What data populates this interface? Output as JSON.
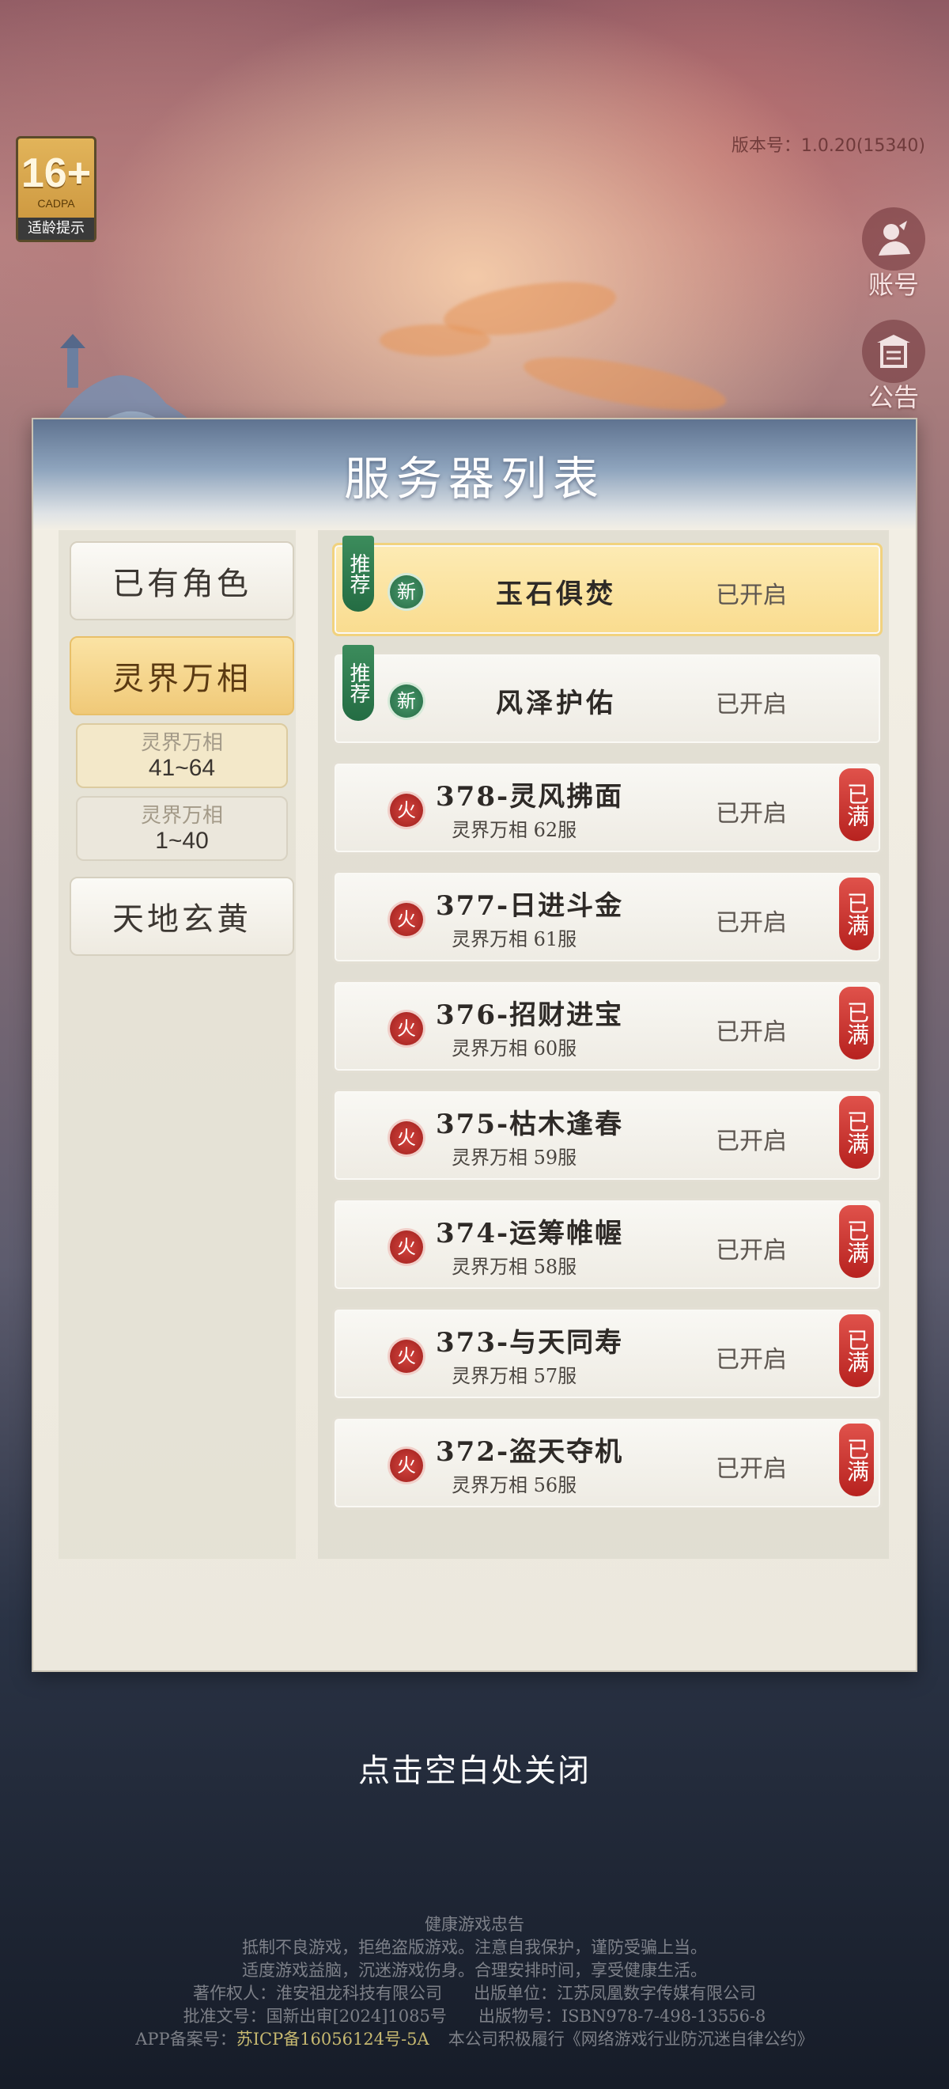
{
  "age_rating": {
    "label": "16+",
    "org": "CADPA",
    "tip": "适龄提示"
  },
  "version": "版本号：1.0.20(15340)",
  "side_buttons": [
    {
      "label": "账号",
      "icon": "account-icon"
    },
    {
      "label": "公告",
      "icon": "notice-icon"
    }
  ],
  "panel": {
    "title": "服务器列表",
    "categories": [
      {
        "label": "已有角色"
      },
      {
        "label": "灵界万相"
      },
      {
        "label": "天地玄黄"
      }
    ],
    "sub_ranges": [
      {
        "title": "灵界万相",
        "range": "41~64"
      },
      {
        "title": "灵界万相",
        "range": "1~40"
      }
    ],
    "servers": [
      {
        "name": "玉石俱焚",
        "status": "已开启",
        "badge": "新",
        "recommend": "推荐"
      },
      {
        "name": "风泽护佑",
        "status": "已开启",
        "badge": "新",
        "recommend": "推荐"
      },
      {
        "name": "378-灵风拂面",
        "sub": "灵界万相  62服",
        "status": "已开启",
        "badge": "火",
        "full": "已满"
      },
      {
        "name": "377-日进斗金",
        "sub": "灵界万相  61服",
        "status": "已开启",
        "badge": "火",
        "full": "已满"
      },
      {
        "name": "376-招财进宝",
        "sub": "灵界万相  60服",
        "status": "已开启",
        "badge": "火",
        "full": "已满"
      },
      {
        "name": "375-枯木逢春",
        "sub": "灵界万相  59服",
        "status": "已开启",
        "badge": "火",
        "full": "已满"
      },
      {
        "name": "374-运筹帷幄",
        "sub": "灵界万相  58服",
        "status": "已开启",
        "badge": "火",
        "full": "已满"
      },
      {
        "name": "373-与天同寿",
        "sub": "灵界万相  57服",
        "status": "已开启",
        "badge": "火",
        "full": "已满"
      },
      {
        "name": "372-盗天夺机",
        "sub": "灵界万相  56服",
        "status": "已开启",
        "badge": "火",
        "full": "已满"
      }
    ]
  },
  "close_tip": "点击空白处关闭",
  "footer": {
    "title": "健康游戏忠告",
    "line1": "抵制不良游戏，拒绝盗版游戏。注意自我保护，谨防受骗上当。",
    "line2": "适度游戏益脑，沉迷游戏伤身。合理安排时间，享受健康生活。",
    "copyright": "著作权人：淮安祖龙科技有限公司",
    "publisher": "出版单位：江苏凤凰数字传媒有限公司",
    "approval": "批准文号：国新出审[2024]1085号",
    "isbn": "出版物号：ISBN978-7-498-13556-8",
    "icp_label": "APP备案号：",
    "icp": "苏ICP备16056124号-5A",
    "pledge": "本公司积极履行《网络游戏行业防沉迷自律公约》"
  }
}
